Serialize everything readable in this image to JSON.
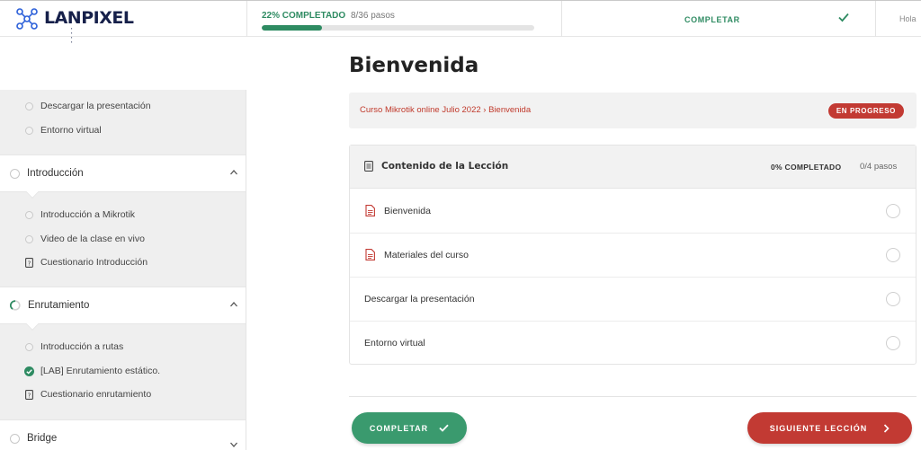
{
  "brand": {
    "name": "LANPIXEL",
    "tagline": "▪ ▪ ▪ ▪"
  },
  "header": {
    "progress_percent_label": "22% COMPLETADO",
    "progress_steps": "8/36 pasos",
    "progress_fraction": 0.22,
    "complete_label": "COMPLETAR",
    "greeting": "Hola"
  },
  "sidebar": {
    "pre_items": [
      {
        "label": "Descargar la presentación",
        "icon": "circle-icon"
      },
      {
        "label": "Entorno virtual",
        "icon": "circle-icon"
      }
    ],
    "sections": [
      {
        "title": "Introducción",
        "status": "not-started",
        "expanded": true,
        "items": [
          {
            "label": "Introducción a Mikrotik",
            "icon": "circle-icon"
          },
          {
            "label": "Video de la clase en vivo",
            "icon": "circle-icon"
          },
          {
            "label": "Cuestionario Introducción",
            "icon": "quiz-icon"
          }
        ]
      },
      {
        "title": "Enrutamiento",
        "status": "in-progress",
        "expanded": true,
        "items": [
          {
            "label": "Introducción a rutas",
            "icon": "circle-icon"
          },
          {
            "label": "[LAB] Enrutamiento estático.",
            "icon": "check-icon"
          },
          {
            "label": "Cuestionario enrutamiento",
            "icon": "quiz-icon"
          }
        ]
      },
      {
        "title": "Bridge",
        "status": "not-started",
        "expanded": false
      }
    ]
  },
  "main": {
    "title": "Bienvenida",
    "breadcrumb": "Curso Mikrotik online Julio 2022 › Bienvenida",
    "status": "EN PROGRESO",
    "lesson": {
      "header": "Contenido de la Lección",
      "percent": "0% COMPLETADO",
      "steps": "0/4 pasos",
      "rows": [
        {
          "label": "Bienvenida",
          "icon": "pdf-icon"
        },
        {
          "label": "Materiales del curso",
          "icon": "pdf-icon"
        },
        {
          "label": "Descargar la presentación",
          "icon": ""
        },
        {
          "label": "Entorno virtual",
          "icon": ""
        }
      ]
    },
    "buttons": {
      "complete": "COMPLETAR",
      "next": "SIGUIENTE LECCIÓN"
    }
  },
  "colors": {
    "green": "#2e8b62",
    "red": "#c23a33",
    "navy": "#16204a"
  }
}
